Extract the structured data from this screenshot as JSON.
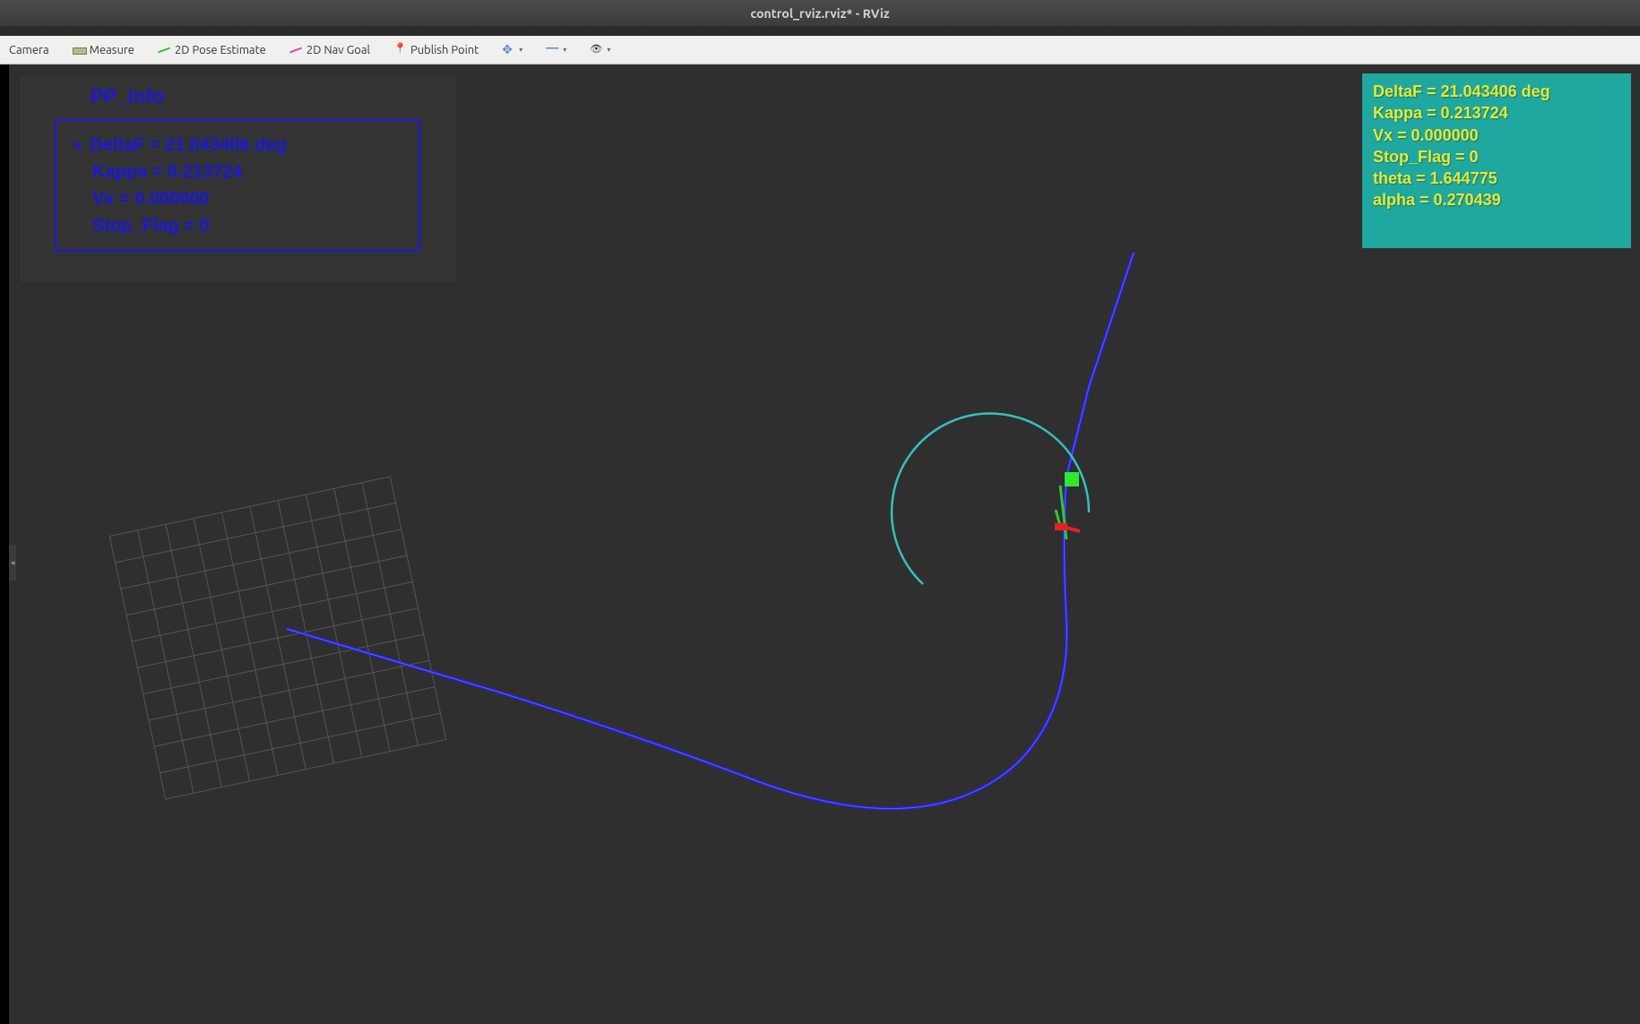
{
  "window": {
    "title": "control_rviz.rviz* - RViz"
  },
  "toolbar": {
    "camera": "Camera",
    "measure": "Measure",
    "pose_estimate": "2D Pose Estimate",
    "nav_goal": "2D Nav Goal",
    "publish_point": "Publish Point"
  },
  "info_panel": {
    "title": "PP_info",
    "lines": {
      "deltaf": "DeltaF = 21.043406 deg",
      "kappa": "Kappa = 0.213724",
      "vx": "Vx = 0.000000",
      "stop_flag": "Stop_Flag = 0"
    }
  },
  "overlay": {
    "deltaf": "DeltaF = 21.043406 deg",
    "kappa": "Kappa = 0.213724",
    "vx": "Vx = 0.000000",
    "stop_flag": "Stop_Flag = 0",
    "theta": "theta = 1.644775",
    "alpha": "alpha = 0.270439"
  },
  "viz": {
    "path_color": "#2222ee",
    "circle_color": "#35c0bd",
    "marker_green": "#2fe82f",
    "marker_red": "#e82020",
    "marker_small_green": "#2fc82f",
    "grid_color": "#555555"
  }
}
